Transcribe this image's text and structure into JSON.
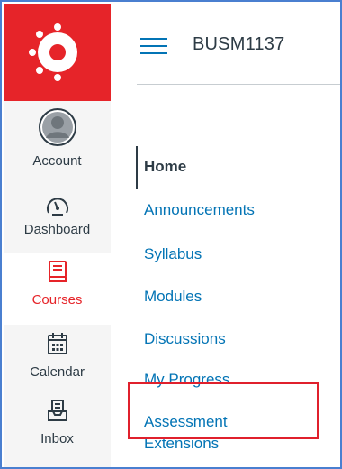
{
  "global_nav": {
    "items": [
      {
        "id": "account",
        "label": "Account",
        "icon": "avatar-icon"
      },
      {
        "id": "dashboard",
        "label": "Dashboard",
        "icon": "speedometer-icon"
      },
      {
        "id": "courses",
        "label": "Courses",
        "icon": "book-icon",
        "active": true
      },
      {
        "id": "calendar",
        "label": "Calendar",
        "icon": "calendar-icon"
      },
      {
        "id": "inbox",
        "label": "Inbox",
        "icon": "inbox-icon"
      }
    ]
  },
  "header": {
    "course_code": "BUSM1137"
  },
  "course_nav": {
    "items": [
      {
        "label": "Home",
        "active": true
      },
      {
        "label": "Announcements"
      },
      {
        "label": "Syllabus"
      },
      {
        "label": "Modules"
      },
      {
        "label": "Discussions"
      },
      {
        "label": "My Progress"
      },
      {
        "label": "Assessment"
      },
      {
        "label": "Extensions"
      }
    ]
  },
  "colors": {
    "brand_red": "#e62429",
    "link_blue": "#0374b5",
    "text_dark": "#2d3b45",
    "frame_blue": "#4a7fd0",
    "highlight_red": "#e0202c"
  }
}
